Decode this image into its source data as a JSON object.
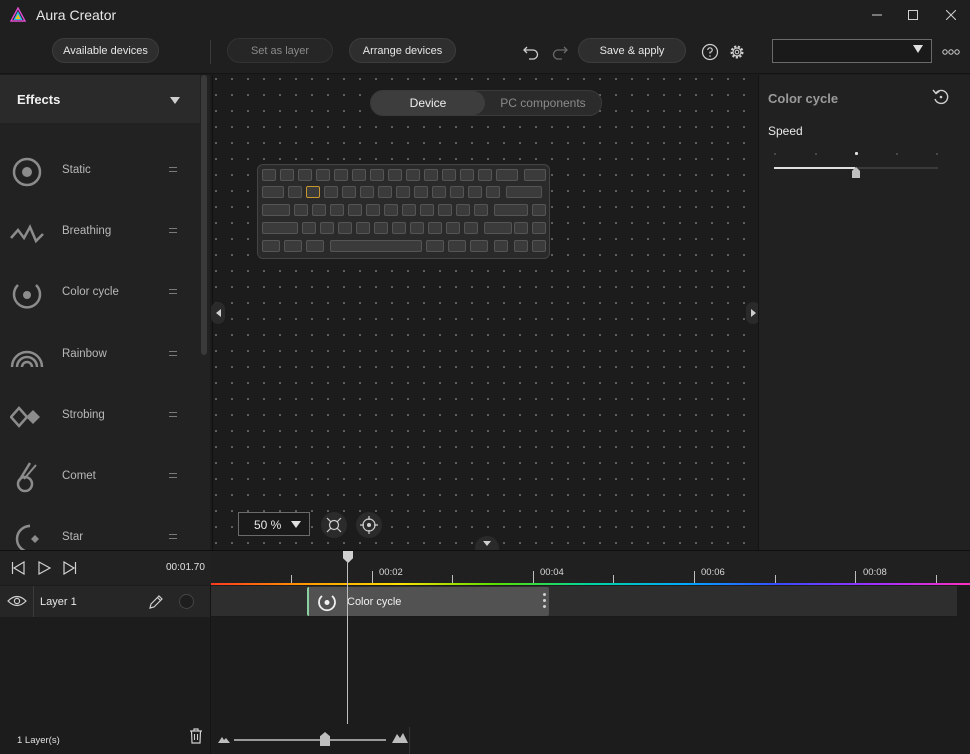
{
  "app": {
    "title": "Aura Creator"
  },
  "toolbar": {
    "available_devices": "Available devices",
    "set_as_layer": "Set as layer",
    "arrange_devices": "Arrange devices",
    "save_apply": "Save & apply",
    "profile_value": ""
  },
  "effects": {
    "title": "Effects",
    "items": [
      {
        "label": "Static",
        "icon": "static-icon"
      },
      {
        "label": "Breathing",
        "icon": "breathing-icon"
      },
      {
        "label": "Color cycle",
        "icon": "color-cycle-icon"
      },
      {
        "label": "Rainbow",
        "icon": "rainbow-icon"
      },
      {
        "label": "Strobing",
        "icon": "strobing-icon"
      },
      {
        "label": "Comet",
        "icon": "comet-icon"
      },
      {
        "label": "Star",
        "icon": "star-icon"
      }
    ]
  },
  "canvas": {
    "tabs": {
      "device": "Device",
      "pc_components": "PC components"
    },
    "active_tab": "Device",
    "zoom": "50 %"
  },
  "properties": {
    "title": "Color cycle",
    "speed_label": "Speed",
    "speed_steps": 5,
    "speed_value_step": 3
  },
  "timeline": {
    "current_time": "00:01.70",
    "ruler_labels": [
      "00:02",
      "00:04",
      "00:06",
      "00:08"
    ],
    "layer": {
      "name": "Layer 1",
      "clip_label": "Color cycle"
    },
    "layer_count": "1  Layer(s)"
  },
  "colors": {
    "accent_selected_key": "#c8962e",
    "clip_edge": "#8ad0a0"
  }
}
